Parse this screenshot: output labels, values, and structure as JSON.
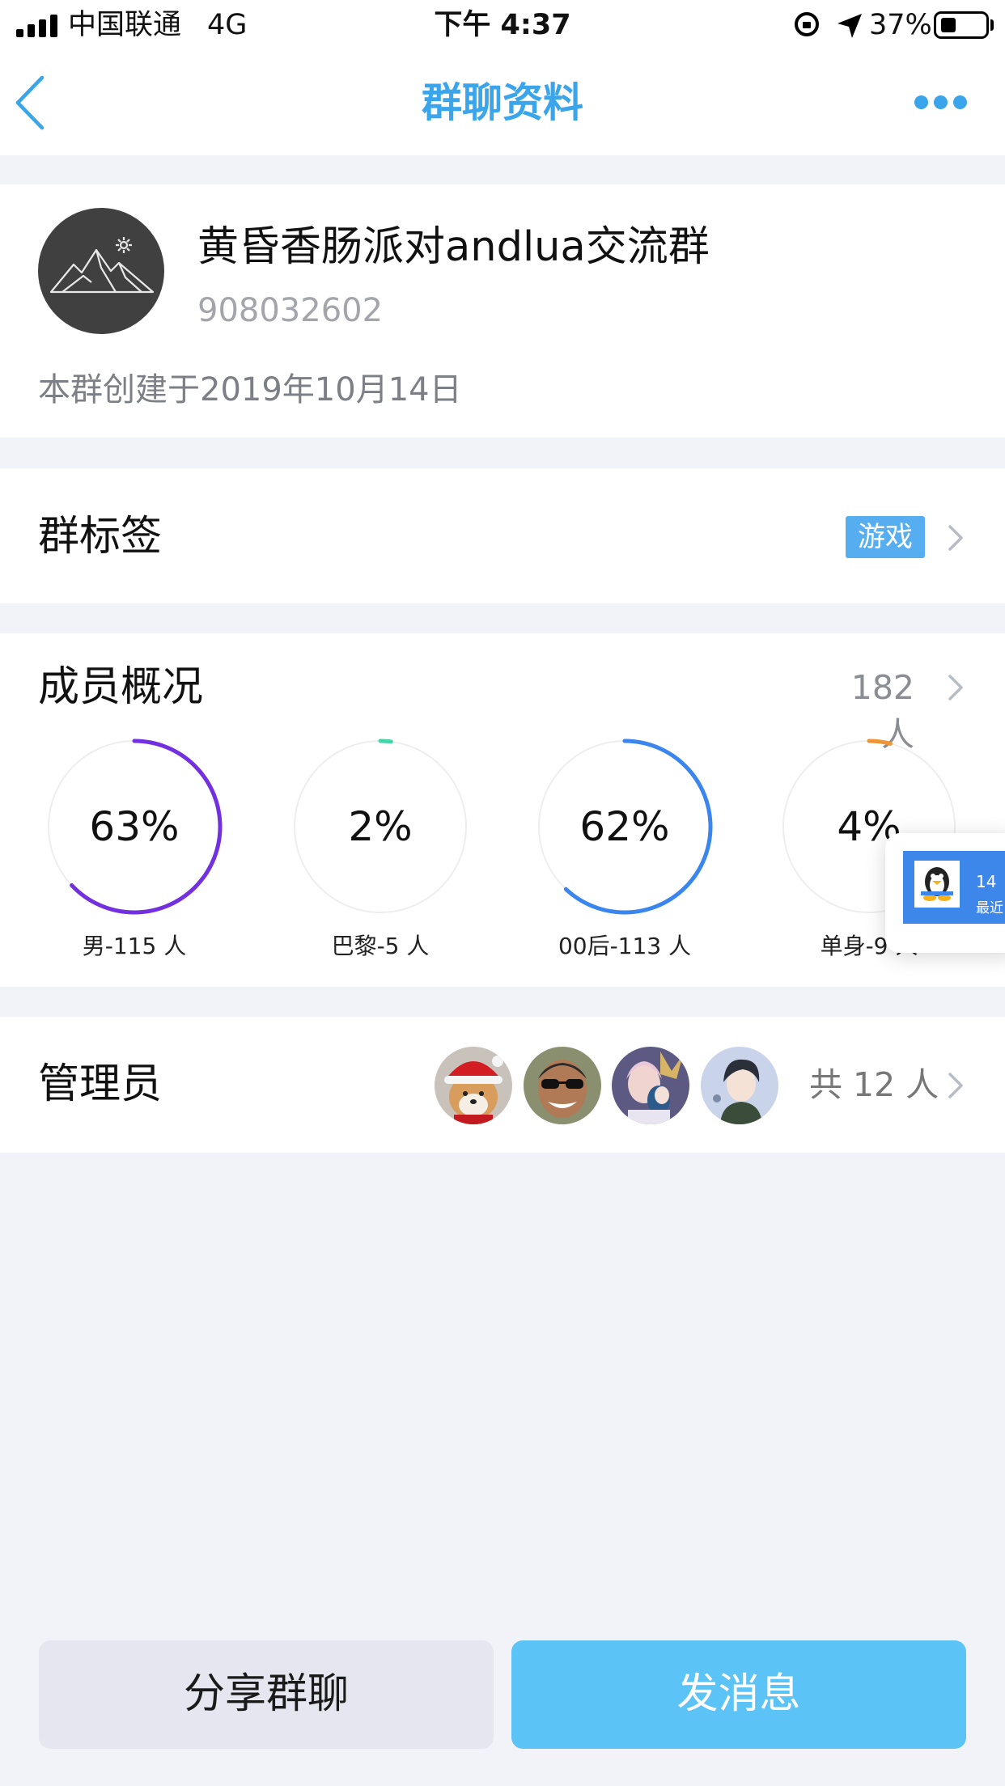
{
  "status_bar": {
    "carrier": "中国联通",
    "network": "4G",
    "time": "下午 4:37",
    "battery": "37%",
    "battery_level": 0.37,
    "icons": [
      "signal-icon",
      "orientation-lock-icon",
      "location-arrow-icon",
      "battery-icon"
    ]
  },
  "nav": {
    "title": "群聊资料",
    "back_icon": "chevron-left-icon",
    "more_icon": "more-dots-icon",
    "accent": "#3aa5ea"
  },
  "group": {
    "name": "黄昏香肠派对andlua交流群",
    "id": "908032602",
    "created": "本群创建于2019年10月14日",
    "avatar_icon": "mountain-avatar-icon"
  },
  "tags": {
    "label": "群标签",
    "tag": "游戏"
  },
  "members": {
    "label": "成员概况",
    "count": "182 人",
    "stats": [
      {
        "value": "63%",
        "fraction": 0.63,
        "label": "男-115 人",
        "color": "#7330e0"
      },
      {
        "value": "2%",
        "fraction": 0.02,
        "label": "巴黎-5 人",
        "color": "#44d4a8"
      },
      {
        "value": "62%",
        "fraction": 0.62,
        "label": "00后-113 人",
        "color": "#3a86ee"
      },
      {
        "value": "4%",
        "fraction": 0.04,
        "label": "单身-9 人",
        "color": "#f09535"
      }
    ],
    "float_widget": {
      "line1": "14",
      "line2": "最近"
    }
  },
  "admins": {
    "label": "管理员",
    "total": "共 12 人",
    "avatars": [
      "shiba-santa-avatar",
      "sunglasses-man-avatar",
      "anime-couple-avatar",
      "anime-boy-avatar"
    ]
  },
  "actions": {
    "share": "分享群聊",
    "send": "发消息"
  }
}
